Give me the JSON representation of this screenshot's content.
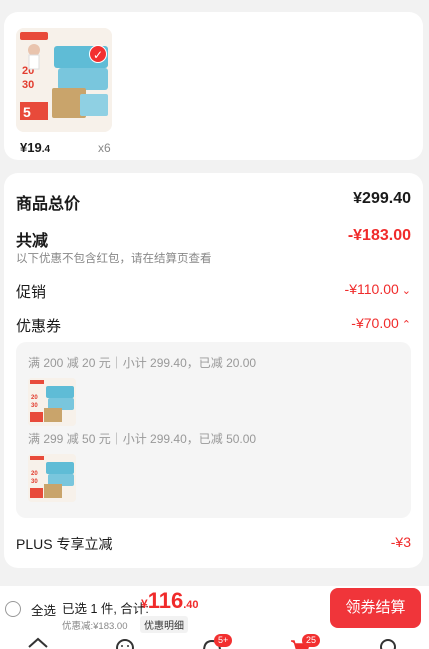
{
  "item": {
    "price_symbol": "¥",
    "price_int": "19",
    "price_dec": ".4",
    "quantity": "x6",
    "selected": true
  },
  "summary": {
    "total_label": "商品总价",
    "total_value": "¥299.40",
    "reduce_label": "共减",
    "reduce_value": "-¥183.00",
    "reduce_note": "以下优惠不包含红包，请在结算页查看",
    "promo_label": "促销",
    "promo_value": "-¥110.00",
    "coupon_label": "优惠券",
    "coupon_value": "-¥70.00",
    "coupon_rules": [
      "满 200 减 20 元｜小计 299.40，已减 20.00",
      "满 299 减 50 元｜小计 299.40，已减 50.00"
    ],
    "plus_label": "PLUS 专享立减",
    "plus_value": "-¥3"
  },
  "bottom": {
    "select_all": "全选",
    "selected_total": "已选 1 件, 合计:",
    "currency": "¥",
    "amount_int": "116",
    "amount_dec": ".40",
    "discount_line": "优惠减:¥183.00",
    "detail_label": "优惠明细",
    "checkout_label": "领券结算",
    "badge_messages": "5+",
    "badge_cart": "25"
  },
  "colors": {
    "accent": "#f02b2b",
    "checkout": "#f0353a"
  }
}
